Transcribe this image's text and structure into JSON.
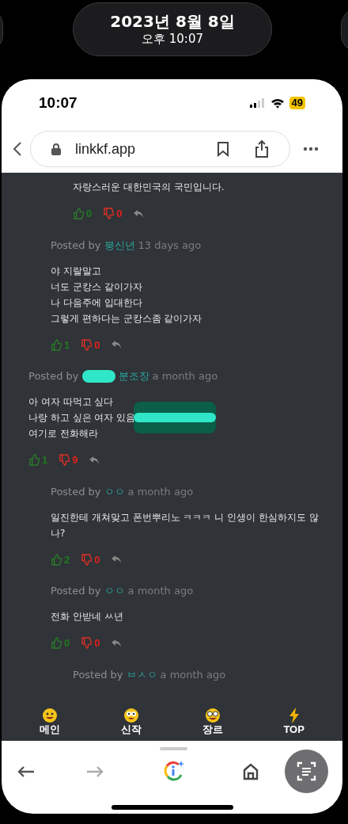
{
  "lock_screen": {
    "date": "2023년 8월 8일",
    "time": "오후 10:07"
  },
  "status_bar": {
    "time": "10:07",
    "battery": "49"
  },
  "browser": {
    "url": "linkkf.app"
  },
  "comments": [
    {
      "children": [
        {
          "children": [
            {
              "lines": [
                "자랑스러운 대한민국의 국민입니다."
              ],
              "likes": "0",
              "dislikes": "0"
            }
          ]
        },
        {
          "posted_by": "Posted by",
          "author": "붕신년",
          "time": "13 days ago",
          "lines": [
            "야 지랄말고",
            "너도 군캉스 같이가자",
            "나 다음주에 입대한다",
            "그렇게 편하다는 군캉스좀 같이가자"
          ],
          "likes": "1",
          "dislikes": "0"
        }
      ]
    },
    {
      "posted_by": "Posted by",
      "author": "분조장",
      "author_redacted": true,
      "time": "a month ago",
      "lines": [
        "아 여자 따먹고 싶다",
        "나랑 하고 싶은 여자 있음",
        "여기로 전화해라"
      ],
      "lines_redacted": [
        false,
        true,
        false
      ],
      "likes": "1",
      "dislikes": "9",
      "children": [
        {
          "posted_by": "Posted by",
          "author": "ㅇㅇ",
          "time": "a month ago",
          "lines": [
            "일진한테 개쳐맞고 폰번뿌리노 ㅋㅋㅋ 니 인생이 한심하지도 않나?"
          ],
          "likes": "2",
          "dislikes": "0"
        },
        {
          "posted_by": "Posted by",
          "author": "ㅇㅇ",
          "time": "a month ago",
          "lines": [
            "전화 안받네 ㅆ년"
          ],
          "likes": "0",
          "dislikes": "0",
          "children": [
            {
              "posted_by": "Posted by",
              "author": "ㅂㅅㅇ",
              "time": "a month ago"
            }
          ]
        }
      ]
    }
  ],
  "bottom_nav": [
    {
      "label": "메인",
      "kind": "smile"
    },
    {
      "label": "신작",
      "kind": "googly"
    },
    {
      "label": "장르",
      "kind": "glasses"
    },
    {
      "label": "TOP",
      "kind": "bolt"
    }
  ]
}
